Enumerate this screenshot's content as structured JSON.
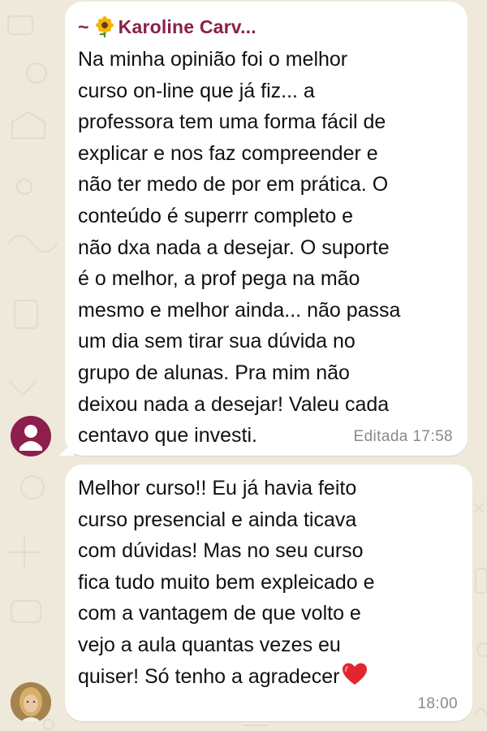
{
  "colors": {
    "chat_background": "#efe9dc",
    "bubble": "#ffffff",
    "sender_name": "#8a1f4b",
    "avatar_default": "#8e1e4c",
    "timestamp": "#8a8a8a",
    "text": "#111111"
  },
  "messages": [
    {
      "sender_prefix": "~",
      "sender_emoji": "sunflower-icon",
      "sender_name": "Karoline Carv...",
      "text": "Na minha opinião foi o melhor\ncurso on-line que já fiz... a\nprofessora tem uma forma fácil de\nexplicar e nos faz compreender e\nnão ter medo de por em prática. O\nconteúdo é superrr completo e\nnão dxa nada a desejar. O suporte\né o melhor, a prof pega na mão\nmesmo e melhor ainda... não passa\num dia sem tirar sua dúvida no\ngrupo de alunas. Pra mim não\ndeixou nada a desejar! Valeu cada\ncentavo que investi.",
      "edited_label": "Editada",
      "time": "17:58",
      "avatar": "default-user-avatar-icon"
    },
    {
      "text": "Melhor curso!! Eu já havia feito\ncurso presencial e ainda ticava\ncom dúvidas! Mas no seu curso\nfica tudo muito bem expleicado e\ncom a vantagem de que volto e\nvejo a aula quantas vezes eu\nquiser!  Só tenho a agradecer",
      "trailing_emoji": "red-heart-icon",
      "time": "18:00",
      "avatar": "user-photo-avatar"
    }
  ]
}
